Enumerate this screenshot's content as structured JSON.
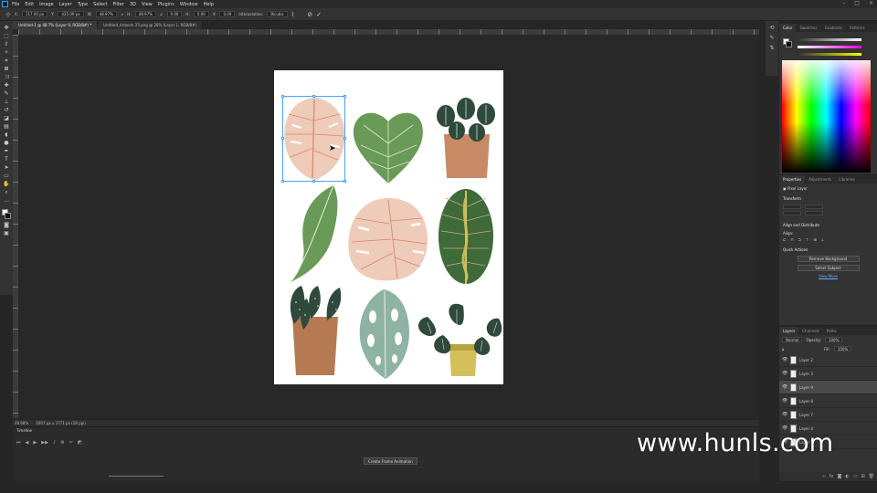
{
  "menubar": {
    "items": [
      "File",
      "Edit",
      "Image",
      "Layer",
      "Type",
      "Select",
      "Filter",
      "3D",
      "View",
      "Plugins",
      "Window",
      "Help"
    ]
  },
  "options": {
    "x": "117.00 px",
    "y": "425.09 px",
    "w": "48.97%",
    "h": "48.97%",
    "angle": "0.00",
    "h_skew": "0.00",
    "v_skew": "0.00",
    "interpolation_label": "Interpolation:",
    "interpolation_value": "Bicubic"
  },
  "tabs": [
    {
      "label": "Untitled-1 @ 48.7% (Layer 9, RGB/8#) *",
      "active": true
    },
    {
      "label": "Untitled_Artwork 25.png @ 26% (Layer 1, RGB/8#)",
      "active": false
    }
  ],
  "status": {
    "zoom": "48.68%",
    "doc_size": "2007 px x 3771 px (28 ppi)"
  },
  "timeline": {
    "title": "Timeline",
    "create_frame": "Create Frame Animation"
  },
  "color_panel": {
    "tabs": [
      "Color",
      "Swatches",
      "Gradients",
      "Patterns"
    ],
    "colors": {
      "fg": "#ffffff",
      "bg": "#111111"
    }
  },
  "properties": {
    "tabs": [
      "Properties",
      "Adjustments",
      "Libraries"
    ],
    "layer_kind": "Pixel Layer",
    "transform_title": "Transform",
    "align_title": "Align and Distribute",
    "align_label": "Align:",
    "quick_actions_title": "Quick Actions",
    "remove_bg": "Remove Background",
    "select_subject": "Select Subject",
    "view_more": "View More"
  },
  "layers": {
    "tabs": [
      "Layers",
      "Channels",
      "Paths"
    ],
    "blend_mode": "Normal",
    "opacity_label": "Opacity:",
    "opacity": "100%",
    "fill_label": "Fill:",
    "fill": "100%",
    "rows": [
      {
        "name": "Layer 2",
        "selected": false
      },
      {
        "name": "Layer 3",
        "selected": false
      },
      {
        "name": "Layer 9",
        "selected": true
      },
      {
        "name": "Layer 8",
        "selected": false
      },
      {
        "name": "Layer 7",
        "selected": false
      },
      {
        "name": "Layer 4",
        "selected": false
      },
      {
        "name": "Layer 1",
        "selected": false
      }
    ]
  },
  "artwork": {
    "colors": {
      "pink": "#efcbb9",
      "pink_vein": "#d9826a",
      "green": "#6a9a58",
      "dark_green": "#3f6b3a",
      "teal": "#8fb3a3",
      "terracotta": "#c78a64",
      "mustard": "#d4c05a",
      "dark": "#2f4a3c"
    }
  },
  "watermark": "www.hunls.com"
}
